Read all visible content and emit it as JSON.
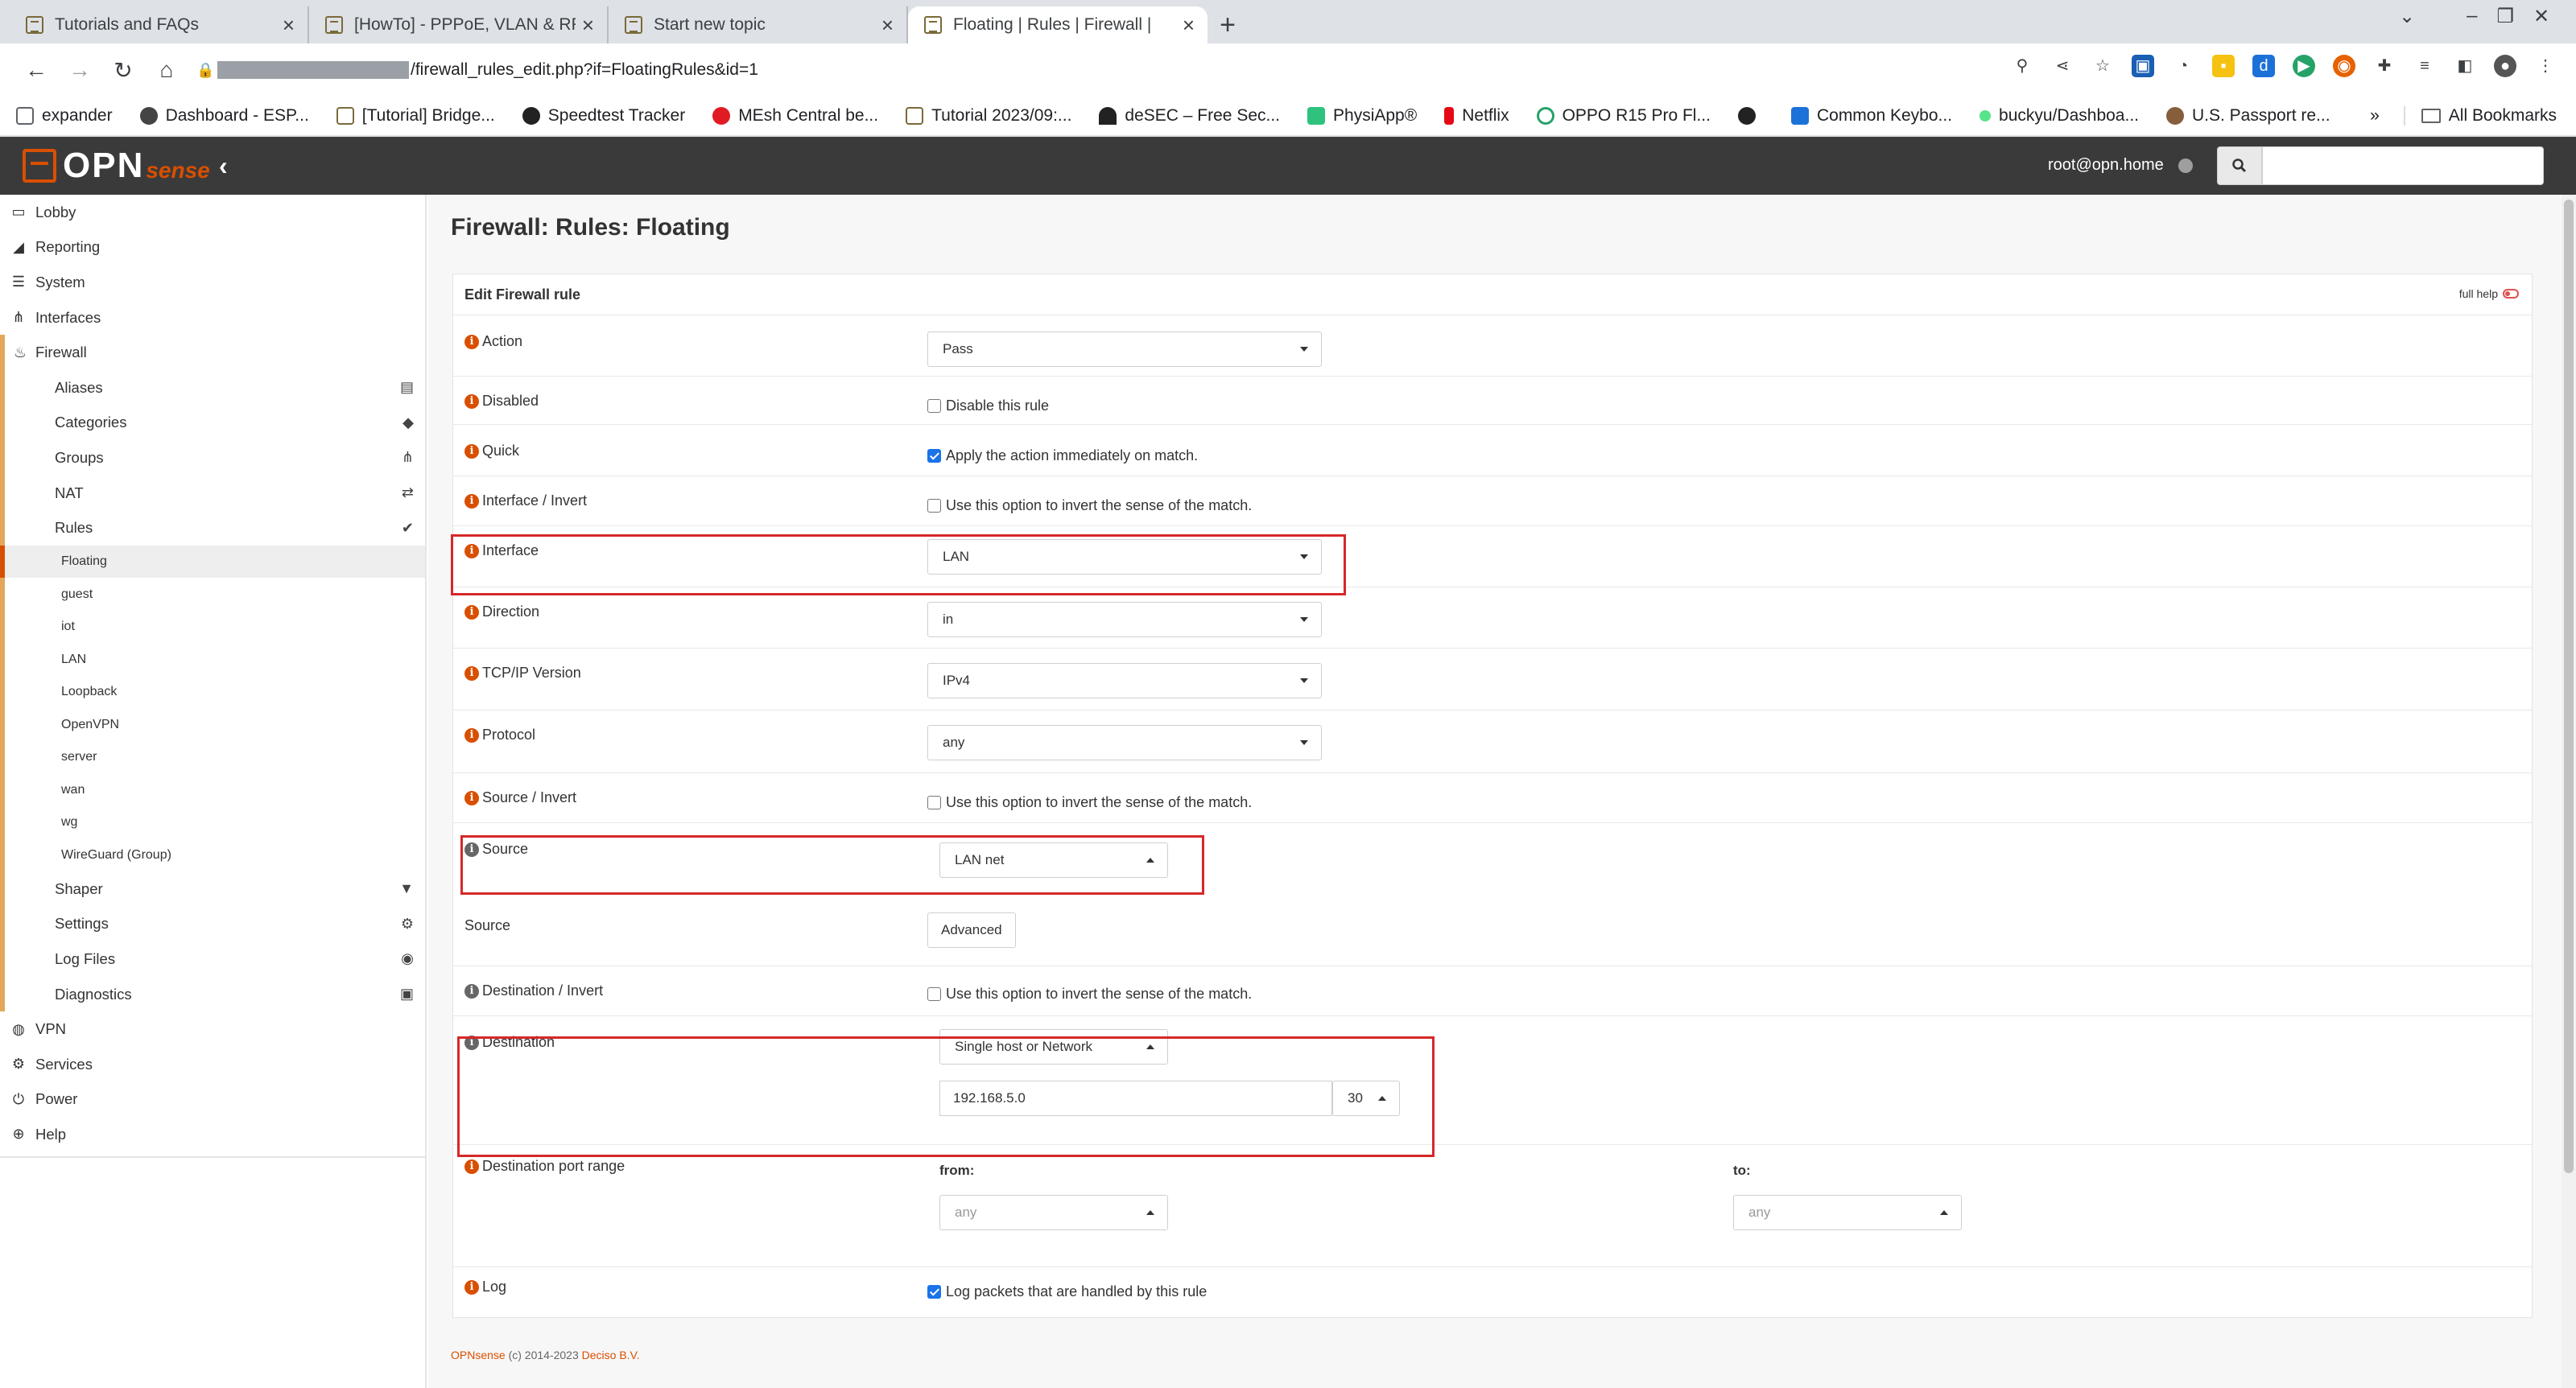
{
  "browser": {
    "tabs": [
      {
        "title": "Tutorials and FAQs",
        "active": false
      },
      {
        "title": "[HowTo] - PPPoE, VLAN & RF",
        "active": false
      },
      {
        "title": "Start new topic",
        "active": false
      },
      {
        "title": "Floating | Rules | Firewall |",
        "active": true
      }
    ],
    "url": "/firewall_rules_edit.php?if=FloatingRules&id=1",
    "bookmarks": [
      "expander",
      "Dashboard - ESP...",
      "[Tutorial] Bridge...",
      "Speedtest Tracker",
      "MEsh Central be...",
      "Tutorial 2023/09:...",
      "deSEC – Free Sec...",
      "PhysiApp®",
      "Netflix",
      "OPPO R15 Pro Fl...",
      "",
      "Common Keybo...",
      "buckyu/Dashboa...",
      "U.S. Passport re..."
    ],
    "bookmarks_overflow": "»",
    "all_bookmarks": "All Bookmarks"
  },
  "header": {
    "logo_opn": "OPN",
    "logo_sense": "sense",
    "user": "root@opn.home",
    "search_placeholder": ""
  },
  "sidebar": {
    "top": [
      {
        "label": "Lobby",
        "icon": "laptop-icon"
      },
      {
        "label": "Reporting",
        "icon": "chart-icon"
      },
      {
        "label": "System",
        "icon": "server-icon"
      },
      {
        "label": "Interfaces",
        "icon": "sitemap-icon"
      },
      {
        "label": "Firewall",
        "icon": "fire-icon"
      }
    ],
    "firewall_sub": [
      {
        "label": "Aliases",
        "icon": "list-icon"
      },
      {
        "label": "Categories",
        "icon": "tags-icon"
      },
      {
        "label": "Groups",
        "icon": "sitemap-icon"
      },
      {
        "label": "NAT",
        "icon": "exchange-icon"
      },
      {
        "label": "Rules",
        "icon": "check-icon"
      }
    ],
    "rules_sub": [
      "Floating",
      "guest",
      "iot",
      "LAN",
      "Loopback",
      "OpenVPN",
      "server",
      "wan",
      "wg",
      "WireGuard (Group)"
    ],
    "firewall_sub2": [
      {
        "label": "Shaper",
        "icon": "filter-icon"
      },
      {
        "label": "Settings",
        "icon": "cogs-icon"
      },
      {
        "label": "Log Files",
        "icon": "eye-icon"
      },
      {
        "label": "Diagnostics",
        "icon": "medkit-icon"
      }
    ],
    "bottom": [
      {
        "label": "VPN",
        "icon": "globe-icon"
      },
      {
        "label": "Services",
        "icon": "gear-icon"
      },
      {
        "label": "Power",
        "icon": "plug-icon"
      },
      {
        "label": "Help",
        "icon": "lifebuoy-icon"
      }
    ]
  },
  "page": {
    "title": "Firewall: Rules: Floating",
    "panel_title": "Edit Firewall rule",
    "full_help": "full help",
    "fields": {
      "action": {
        "label": "Action",
        "value": "Pass"
      },
      "disabled": {
        "label": "Disabled",
        "text": "Disable this rule",
        "checked": false
      },
      "quick": {
        "label": "Quick",
        "text": "Apply the action immediately on match.",
        "checked": true
      },
      "interface_invert": {
        "label": "Interface / Invert",
        "text": "Use this option to invert the sense of the match.",
        "checked": false
      },
      "interface": {
        "label": "Interface",
        "value": "LAN"
      },
      "direction": {
        "label": "Direction",
        "value": "in"
      },
      "ipversion": {
        "label": "TCP/IP Version",
        "value": "IPv4"
      },
      "protocol": {
        "label": "Protocol",
        "value": "any"
      },
      "source_invert": {
        "label": "Source / Invert",
        "text": "Use this option to invert the sense of the match.",
        "checked": false
      },
      "source": {
        "label": "Source",
        "value": "LAN net"
      },
      "source_adv": {
        "label": "Source",
        "button": "Advanced"
      },
      "destination_invert": {
        "label": "Destination / Invert",
        "text": "Use this option to invert the sense of the match.",
        "checked": false
      },
      "destination": {
        "label": "Destination",
        "type_value": "Single host or Network",
        "address": "192.168.5.0",
        "mask": "30"
      },
      "dest_port": {
        "label": "Destination port range",
        "from_label": "from:",
        "to_label": "to:",
        "from_value": "any",
        "to_value": "any"
      },
      "log": {
        "label": "Log",
        "text": "Log packets that are handled by this rule",
        "checked": true
      }
    },
    "footer_brand": "OPNsense",
    "footer_text": " (c) 2014-2023 ",
    "footer_company": "Deciso B.V."
  },
  "colors": {
    "accent": "#d94f00",
    "header_bg": "#3a3a3a",
    "highlight_box": "#d62828"
  }
}
